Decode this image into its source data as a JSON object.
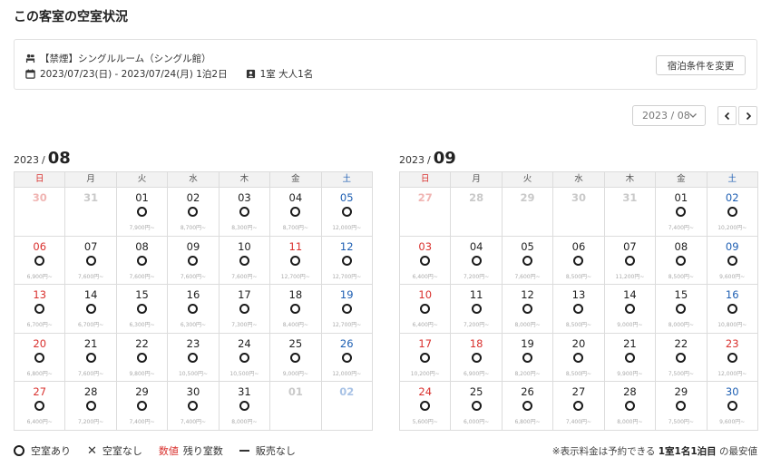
{
  "page_title": "この客室の空室状況",
  "room": {
    "name": "【禁煙】シングルルーム（シングル館）",
    "dates": "2023/07/23(日) - 2023/07/24(月) 1泊2日",
    "guests": "1室 大人1名",
    "change_button": "宿泊条件を変更"
  },
  "month_select": "2023 / 08",
  "weekdays": [
    "日",
    "月",
    "火",
    "水",
    "木",
    "金",
    "土"
  ],
  "calendars": [
    {
      "year": "2023",
      "sep": "/",
      "month": "08",
      "weeks": [
        [
          {
            "d": "30",
            "out": true
          },
          {
            "d": "31",
            "out": true
          },
          {
            "d": "01",
            "p": "7,900円~"
          },
          {
            "d": "02",
            "p": "8,700円~"
          },
          {
            "d": "03",
            "p": "8,300円~"
          },
          {
            "d": "04",
            "p": "8,700円~"
          },
          {
            "d": "05",
            "p": "12,000円~"
          }
        ],
        [
          {
            "d": "06",
            "p": "6,900円~"
          },
          {
            "d": "07",
            "p": "7,600円~"
          },
          {
            "d": "08",
            "p": "7,600円~"
          },
          {
            "d": "09",
            "p": "7,600円~"
          },
          {
            "d": "10",
            "p": "7,600円~"
          },
          {
            "d": "11",
            "p": "12,700円~",
            "hol": true
          },
          {
            "d": "12",
            "p": "12,700円~"
          }
        ],
        [
          {
            "d": "13",
            "p": "6,700円~"
          },
          {
            "d": "14",
            "p": "6,700円~"
          },
          {
            "d": "15",
            "p": "6,300円~"
          },
          {
            "d": "16",
            "p": "6,300円~"
          },
          {
            "d": "17",
            "p": "7,300円~"
          },
          {
            "d": "18",
            "p": "8,400円~"
          },
          {
            "d": "19",
            "p": "12,700円~"
          }
        ],
        [
          {
            "d": "20",
            "p": "6,800円~"
          },
          {
            "d": "21",
            "p": "7,600円~"
          },
          {
            "d": "22",
            "p": "9,800円~"
          },
          {
            "d": "23",
            "p": "10,500円~"
          },
          {
            "d": "24",
            "p": "10,500円~"
          },
          {
            "d": "25",
            "p": "9,000円~"
          },
          {
            "d": "26",
            "p": "12,000円~"
          }
        ],
        [
          {
            "d": "27",
            "p": "6,400円~"
          },
          {
            "d": "28",
            "p": "7,200円~"
          },
          {
            "d": "29",
            "p": "7,400円~"
          },
          {
            "d": "30",
            "p": "7,400円~"
          },
          {
            "d": "31",
            "p": "8,000円~"
          },
          {
            "d": "01",
            "out": true
          },
          {
            "d": "02",
            "out": true
          }
        ]
      ]
    },
    {
      "year": "2023",
      "sep": "/",
      "month": "09",
      "weeks": [
        [
          {
            "d": "27",
            "out": true
          },
          {
            "d": "28",
            "out": true
          },
          {
            "d": "29",
            "out": true
          },
          {
            "d": "30",
            "out": true
          },
          {
            "d": "31",
            "out": true
          },
          {
            "d": "01",
            "p": "7,400円~"
          },
          {
            "d": "02",
            "p": "10,200円~"
          }
        ],
        [
          {
            "d": "03",
            "p": "6,400円~"
          },
          {
            "d": "04",
            "p": "7,200円~"
          },
          {
            "d": "05",
            "p": "7,600円~"
          },
          {
            "d": "06",
            "p": "8,500円~"
          },
          {
            "d": "07",
            "p": "11,200円~"
          },
          {
            "d": "08",
            "p": "8,500円~"
          },
          {
            "d": "09",
            "p": "9,600円~"
          }
        ],
        [
          {
            "d": "10",
            "p": "6,400円~"
          },
          {
            "d": "11",
            "p": "7,200円~"
          },
          {
            "d": "12",
            "p": "8,000円~"
          },
          {
            "d": "13",
            "p": "8,500円~"
          },
          {
            "d": "14",
            "p": "9,000円~"
          },
          {
            "d": "15",
            "p": "8,000円~"
          },
          {
            "d": "16",
            "p": "10,800円~"
          }
        ],
        [
          {
            "d": "17",
            "p": "10,200円~"
          },
          {
            "d": "18",
            "p": "6,900円~",
            "hol": true
          },
          {
            "d": "19",
            "p": "8,200円~"
          },
          {
            "d": "20",
            "p": "8,500円~"
          },
          {
            "d": "21",
            "p": "9,900円~"
          },
          {
            "d": "22",
            "p": "7,500円~"
          },
          {
            "d": "23",
            "p": "12,000円~",
            "hol": true
          }
        ],
        [
          {
            "d": "24",
            "p": "5,600円~"
          },
          {
            "d": "25",
            "p": "6,000円~"
          },
          {
            "d": "26",
            "p": "6,800円~"
          },
          {
            "d": "27",
            "p": "7,400円~"
          },
          {
            "d": "28",
            "p": "8,000円~"
          },
          {
            "d": "29",
            "p": "7,500円~"
          },
          {
            "d": "30",
            "p": "9,600円~"
          }
        ]
      ]
    }
  ],
  "legend": {
    "available": "空室あり",
    "unavailable": "空室なし",
    "number": "数値",
    "remaining": "残り室数",
    "not_for_sale": "販売なし"
  },
  "note": {
    "prefix": "※表示料金は予約できる",
    "bold": "1室1名1泊目",
    "suffix": "の最安値"
  },
  "colors": {
    "sunday": "#d9312e",
    "saturday": "#1e5fb3",
    "border": "#dcdcdc"
  }
}
